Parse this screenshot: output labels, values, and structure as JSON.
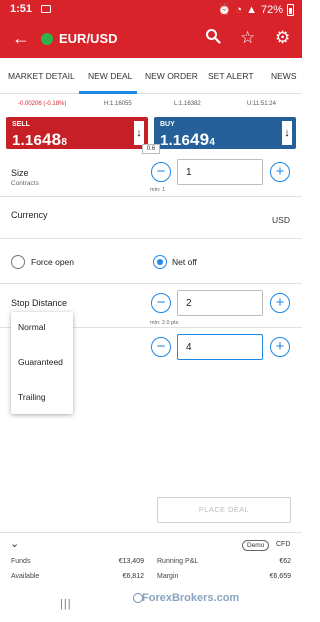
{
  "status_bar": {
    "time": "1:51",
    "battery": "72%"
  },
  "app_bar": {
    "back_icon": "arrow-left-icon",
    "instrument": "EUR/USD",
    "market_status_color": "#2db34a"
  },
  "tabs": [
    {
      "label": "MARKET DETAIL",
      "active": false
    },
    {
      "label": "NEW DEAL",
      "active": true
    },
    {
      "label": "NEW ORDER",
      "active": false
    },
    {
      "label": "SET ALERT",
      "active": false
    },
    {
      "label": "NEWS",
      "active": false
    }
  ],
  "price_info": {
    "change": "-0.00206 (-0.18%)",
    "high": "H:1.16055",
    "low": "L:1.16382",
    "time": "U:11:51:24"
  },
  "sell": {
    "label": "SELL",
    "price_prefix": "1.16",
    "price_big": "48",
    "price_small": "8"
  },
  "buy": {
    "label": "BUY",
    "price_prefix": "1.16",
    "price_big": "49",
    "price_small": "4"
  },
  "spread": "0.6",
  "size": {
    "label": "Size",
    "sublabel": "Contracts",
    "value": "1",
    "hint": "min: 1"
  },
  "currency": {
    "label": "Currency",
    "value": "USD"
  },
  "order_mode": {
    "force_open_label": "Force open",
    "net_off_label": "Net off",
    "selected": "net_off"
  },
  "stop_distance": {
    "label": "Stop Distance",
    "value": "2",
    "hint": "min: 2.0 pts"
  },
  "limit": {
    "value": "4"
  },
  "stop_type_menu": [
    "Normal",
    "Guaranteed",
    "Trailing"
  ],
  "place_deal_label": "PLACE DEAL",
  "summary": {
    "demo_label": "Demo",
    "cfd_label": "CFD",
    "funds_label": "Funds",
    "funds_value": "€13,409",
    "running_pl_label": "Running P&L",
    "running_pl_value": "€62",
    "available_label": "Available",
    "available_value": "€6,812",
    "margin_label": "Margin",
    "margin_value": "€6,659"
  },
  "watermark": "ForexBrokers.com",
  "colors": {
    "brand_red": "#d9232a",
    "sell": "#c62026",
    "buy": "#25609a",
    "accent": "#1e88e5"
  }
}
